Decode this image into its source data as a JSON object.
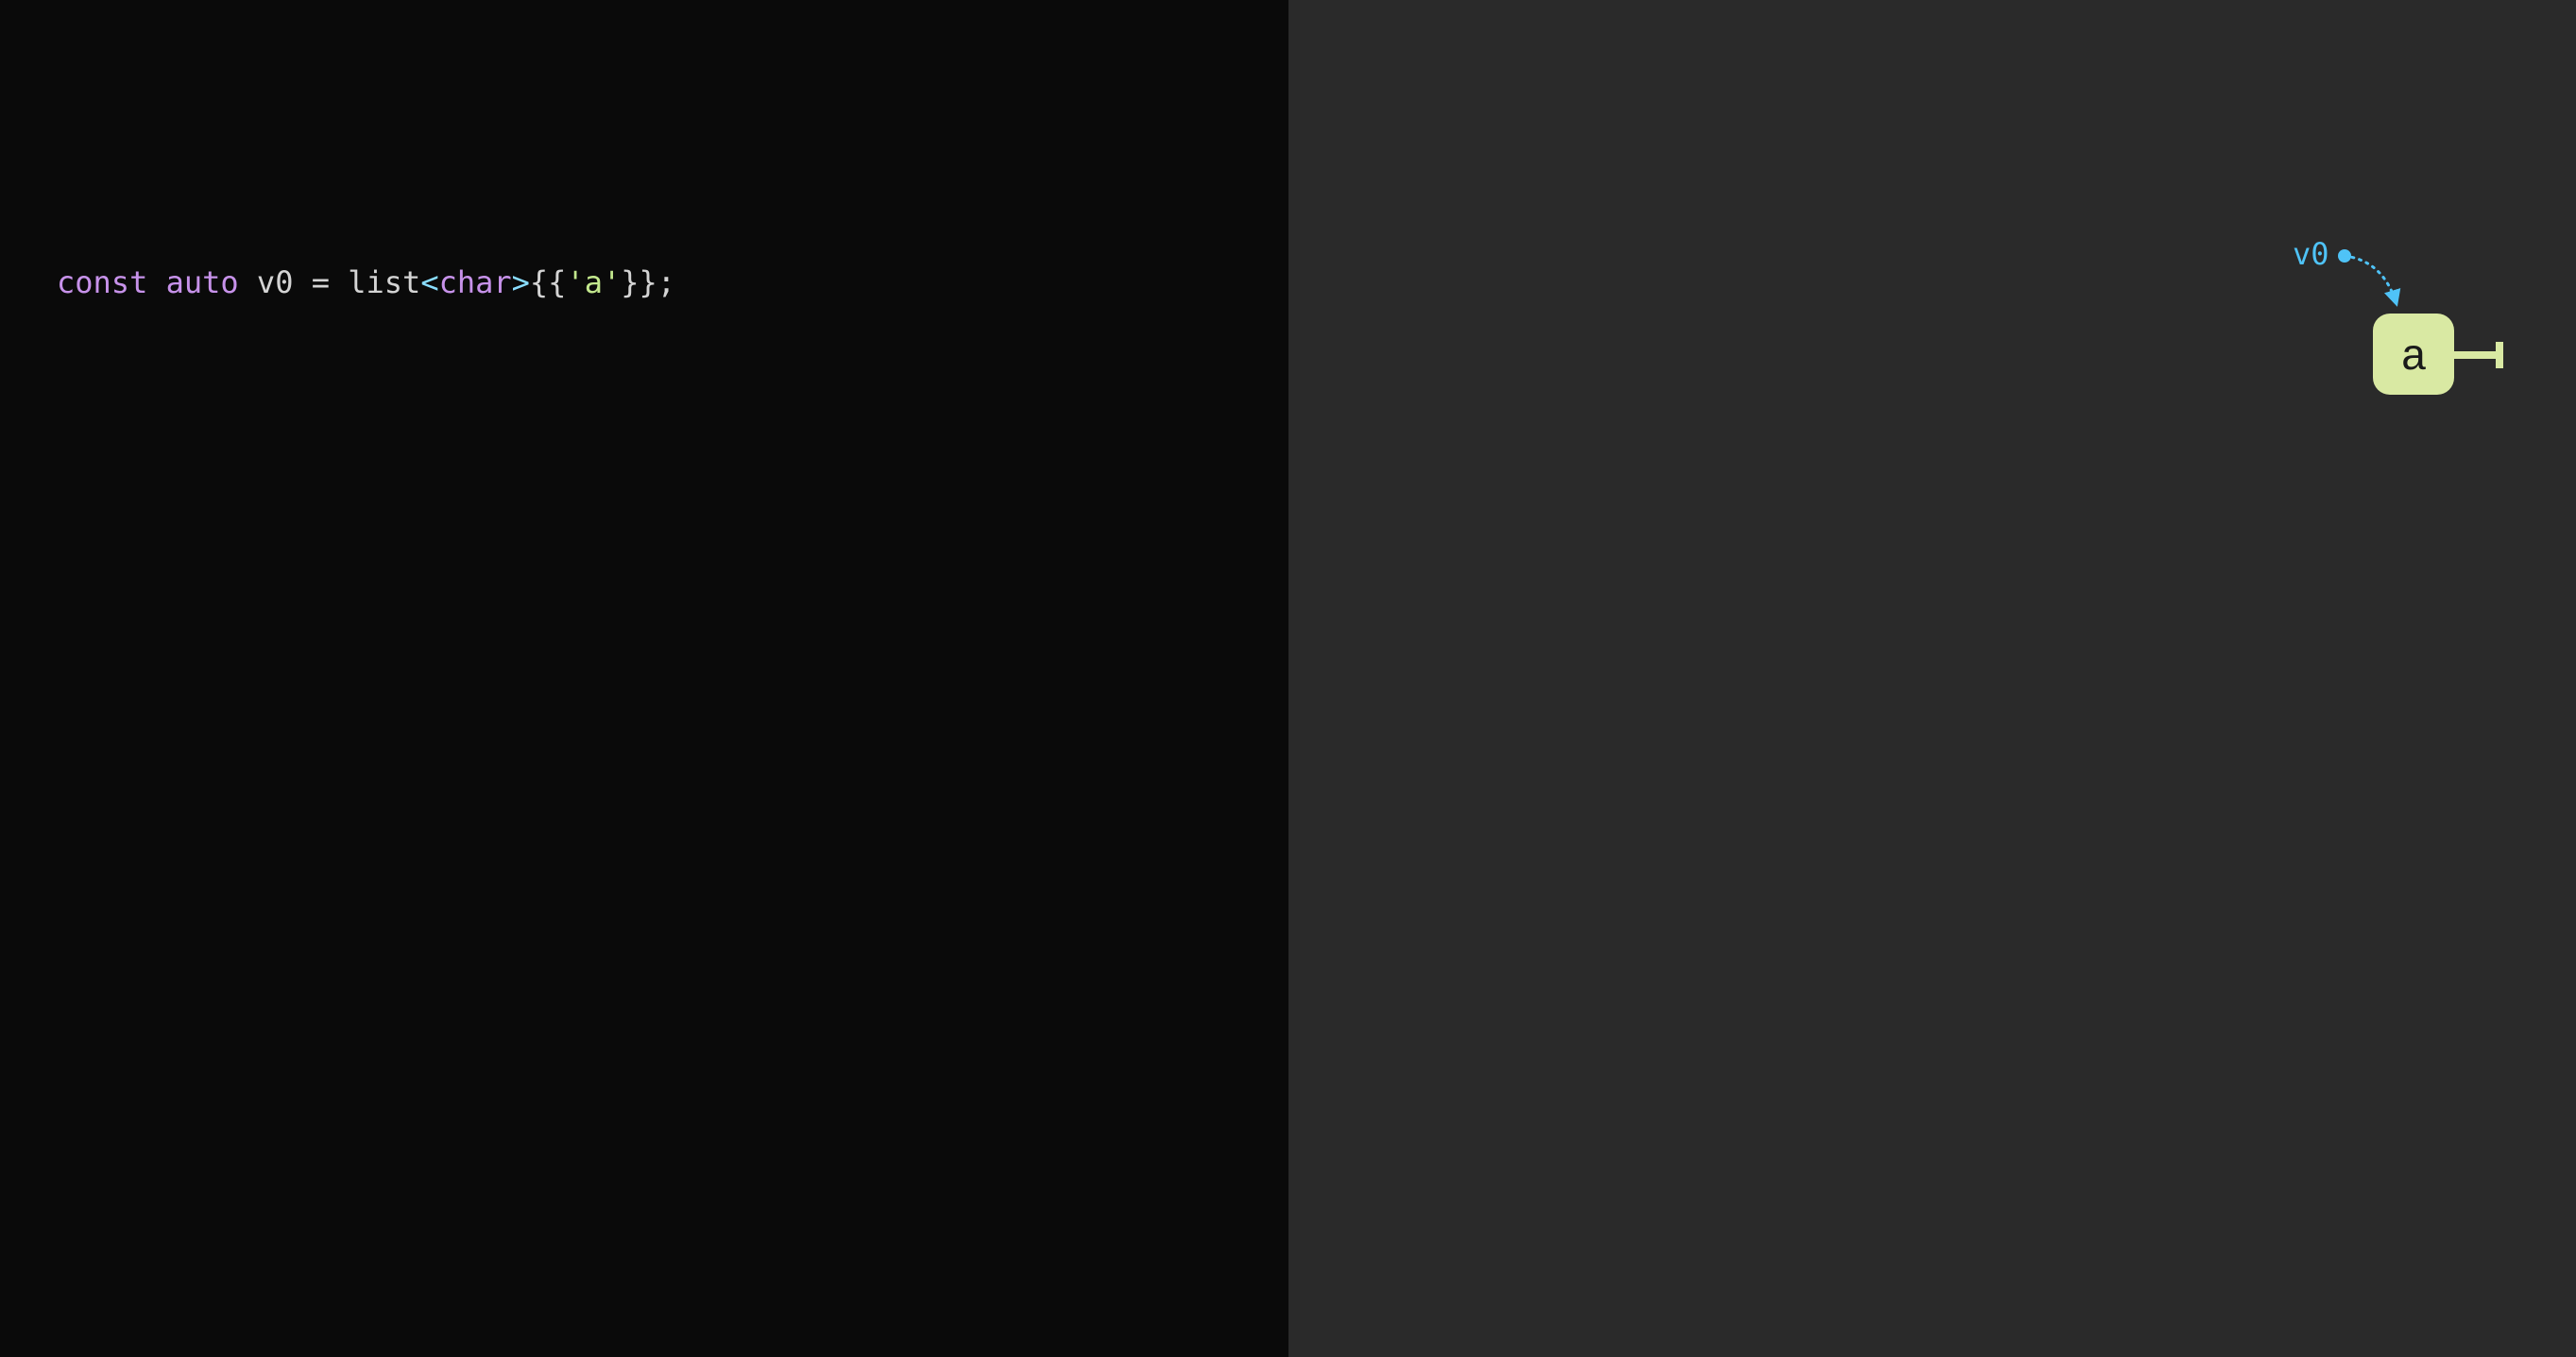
{
  "code": {
    "tokens": {
      "kw_const": "const",
      "kw_auto": "auto",
      "ident_v0": "v0",
      "op_eq": "=",
      "fn_list": "list",
      "angle_open": "<",
      "type_char": "char",
      "angle_close": ">",
      "brace_open2": "{{",
      "str_a": "'a'",
      "brace_close2": "}}",
      "semi": ";"
    }
  },
  "diagram": {
    "variable_label": "v0",
    "node_value": "a",
    "colors": {
      "pointer": "#4fc3f7",
      "node_bg": "#d9e9a3",
      "node_text": "#1a1a1a"
    }
  }
}
